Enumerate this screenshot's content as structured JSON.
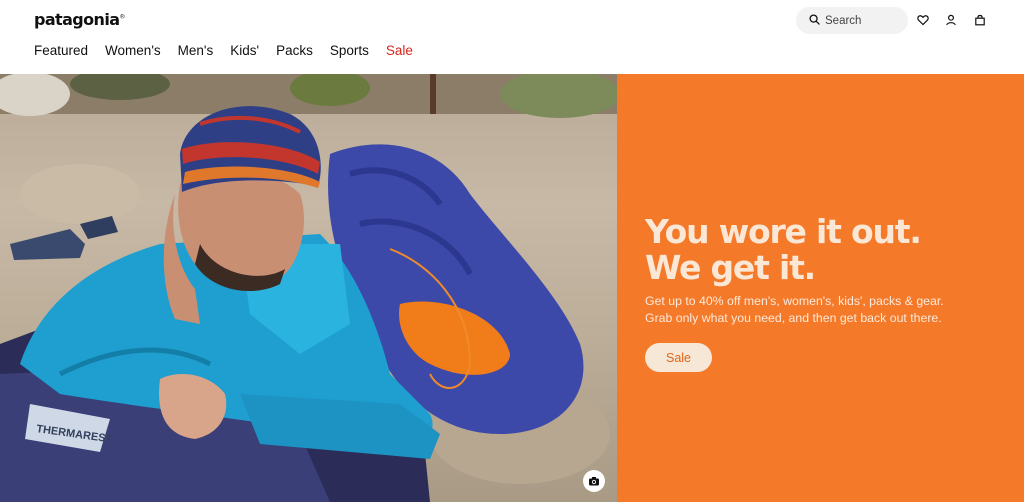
{
  "header": {
    "logo": "patagonia",
    "nav": [
      "Featured",
      "Women's",
      "Men's",
      "Kids'",
      "Packs",
      "Sports",
      "Sale"
    ],
    "search_placeholder": "Search",
    "icons": [
      "search-icon",
      "heart-icon",
      "user-icon",
      "bag-icon"
    ]
  },
  "hero": {
    "headline_line1": "You wore it out.",
    "headline_line2": "We get it.",
    "sub_line1": "Get up to 40% off men's, women's, kids', packs & gear.",
    "sub_line2": "Grab only what you need, and then get back out there.",
    "cta_label": "Sale",
    "photo_text": "THERMAREST",
    "camera_icon": "camera-icon",
    "colors": {
      "promo_bg": "#f47a2a",
      "headline": "#fbe7d6",
      "cta_bg": "#f6e7d6",
      "cta_text": "#e0651b",
      "sale_nav": "#d7261e"
    }
  }
}
